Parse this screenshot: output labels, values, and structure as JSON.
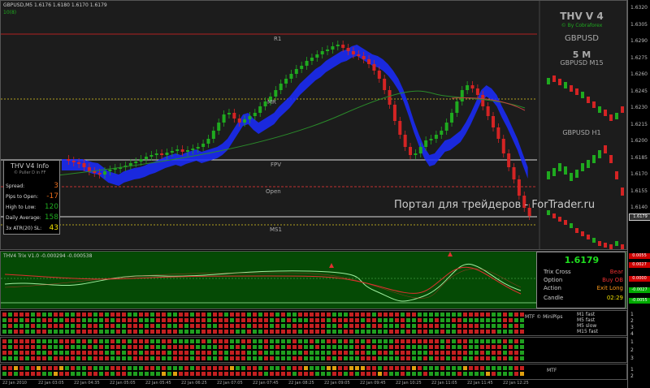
{
  "header": {
    "symbol_line": "GBPUSD,M5  1.6176 1.6180 1.6170 1.6179",
    "sub_line": "10(8)",
    "title": "THV V 4",
    "subtitle": "© By Cobraforex",
    "pair": "GBPUSD",
    "timeframe": "5 M",
    "mtf_m15": "GBPUSD M15",
    "mtf_h1": "GBPUSD H1"
  },
  "levels": {
    "r1": "R1",
    "mr": "MR",
    "fpv": "FPV",
    "open": "Open",
    "ms1": "MS1"
  },
  "price_labels": [
    "1.6320",
    "1.6305",
    "1.6290",
    "1.6275",
    "1.6260",
    "1.6245",
    "1.6230",
    "1.6215",
    "1.6200",
    "1.6185",
    "1.6170",
    "1.6155",
    "1.6140"
  ],
  "current_price_tag": "1.6179",
  "info_box": {
    "title": "THV  V4  Info",
    "subtitle": "© Puller D in FF",
    "rows": [
      {
        "label": "Spread:",
        "value": "3"
      },
      {
        "label": "Pips to Open:",
        "value": "-17"
      },
      {
        "label": "High to Low:",
        "value": "120"
      },
      {
        "label": "Daily Average:",
        "value": "158"
      },
      {
        "label": "3x ATR(20) SL:",
        "value": "43"
      }
    ]
  },
  "watermark": "Портал для трейдеров - ForTrader.ru",
  "indicator": {
    "label": "THV4 Trix V1.0 -0.000294 -0.000538",
    "tags": [
      "0.0055",
      "0.0027",
      "0.0000",
      "-0.0027",
      "-0.0055"
    ]
  },
  "status_box": {
    "price": "1.6179",
    "rows": [
      {
        "label": "Trix Cross",
        "value": "Bear",
        "color": "#e83030"
      },
      {
        "label": "Option",
        "value": "Buy OB",
        "color": "#e83030"
      },
      {
        "label": "Action",
        "value": "Exit Long",
        "color": "#ff9a1a"
      },
      {
        "label": "Candle",
        "value": "02:29",
        "color": "#f0e000"
      }
    ]
  },
  "mtf_panels": {
    "label1": "MTF © MiniPips",
    "legend": [
      "M1 fast",
      "M5 fast",
      "M5 slow",
      "M15 fast"
    ],
    "label3": "MTF",
    "axis1": [
      "1",
      "2",
      "3",
      "4"
    ],
    "axis3": [
      "1",
      "2"
    ]
  },
  "time_labels": [
    "22 Jan 2010",
    "22 Jan 03:05",
    "22 Jan 04:35",
    "22 Jan 05:05",
    "22 Jan 05:45",
    "22 Jan 06:25",
    "22 Jan 07:05",
    "22 Jan 07:45",
    "22 Jan 08:25",
    "22 Jan 09:05",
    "22 Jan 09:45",
    "22 Jan 10:25",
    "22 Jan 11:05",
    "22 Jan 11:45",
    "22 Jan 12:25"
  ],
  "colors": {
    "bull": "#1faa1f",
    "bear": "#d42424",
    "cloud": "#1a2cff",
    "sma": "#2a8a2a",
    "indicator_bg": "#054a05"
  }
}
